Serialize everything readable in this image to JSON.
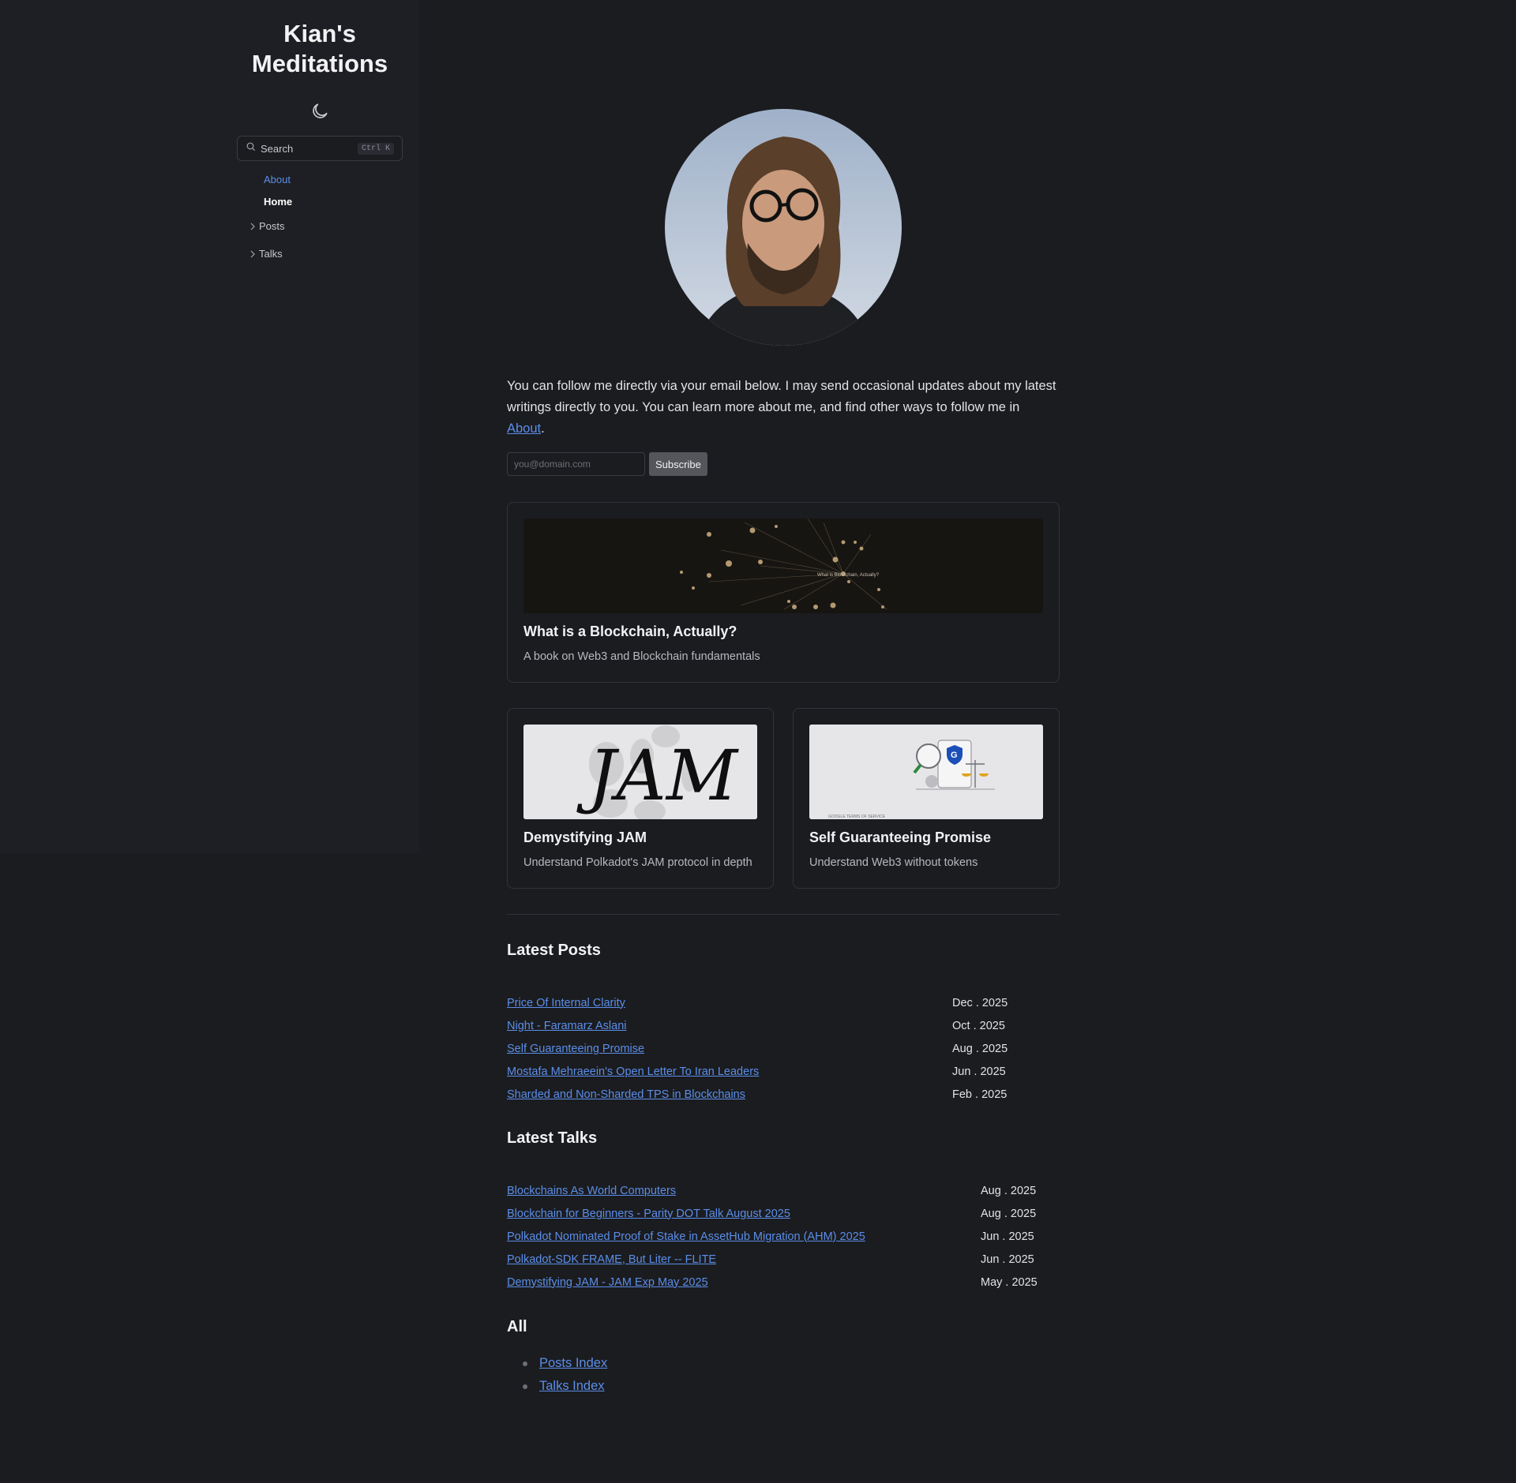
{
  "site": {
    "title": "Kian's Meditations"
  },
  "theme": {
    "icon": "moon-icon"
  },
  "search": {
    "label": "Search",
    "shortcut": "Ctrl K",
    "icon": "search-icon"
  },
  "sidebar": {
    "items": [
      {
        "label": "About",
        "active": false
      },
      {
        "label": "Home",
        "current": true
      },
      {
        "label": "Posts",
        "collapsible": true
      },
      {
        "label": "Talks",
        "collapsible": true
      }
    ]
  },
  "intro": {
    "text": "You can follow me directly via your email below. I may send occasional updates about my latest writings directly to you. You can learn more about me, and find other ways to follow me in ",
    "link": "About",
    "suffix": "."
  },
  "subscribe": {
    "placeholder": "you@domain.com",
    "button": "Subscribe"
  },
  "featured": [
    {
      "title": "What is a Blockchain, Actually?",
      "description": "A book on Web3 and Blockchain fundamentals",
      "image_caption": "What is Blockchain, Actually?"
    },
    {
      "title": "Demystifying JAM",
      "description": "Understand Polkadot's JAM protocol in depth",
      "image_text": "JAM"
    },
    {
      "title": "Self Guaranteeing Promise",
      "description": "Understand Web3 without tokens",
      "image_caption": "GOOGLE TERMS OF SERVICE"
    }
  ],
  "latest_posts": {
    "heading": "Latest Posts",
    "items": [
      {
        "title": "Price Of Internal Clarity",
        "date": "Dec . 2025"
      },
      {
        "title": "Night - Faramarz Aslani",
        "date": "Oct . 2025"
      },
      {
        "title": "Self Guaranteeing Promise",
        "date": "Aug . 2025"
      },
      {
        "title": "Mostafa Mehraeein's Open Letter To Iran Leaders",
        "date": "Jun . 2025"
      },
      {
        "title": "Sharded and Non-Sharded TPS in Blockchains",
        "date": "Feb . 2025"
      }
    ]
  },
  "latest_talks": {
    "heading": "Latest Talks",
    "items": [
      {
        "title": "Blockchains As World Computers",
        "date": "Aug . 2025"
      },
      {
        "title": "Blockchain for Beginners - Parity DOT Talk August 2025",
        "date": "Aug . 2025"
      },
      {
        "title": "Polkadot Nominated Proof of Stake in AssetHub Migration (AHM) 2025",
        "date": "Jun . 2025"
      },
      {
        "title": "Polkadot-SDK FRAME, But Liter -- FLITE",
        "date": "Jun . 2025"
      },
      {
        "title": "Demystifying JAM - JAM Exp May 2025",
        "date": "May . 2025"
      }
    ]
  },
  "all": {
    "heading": "All",
    "links": [
      "Posts Index",
      "Talks Index"
    ]
  }
}
